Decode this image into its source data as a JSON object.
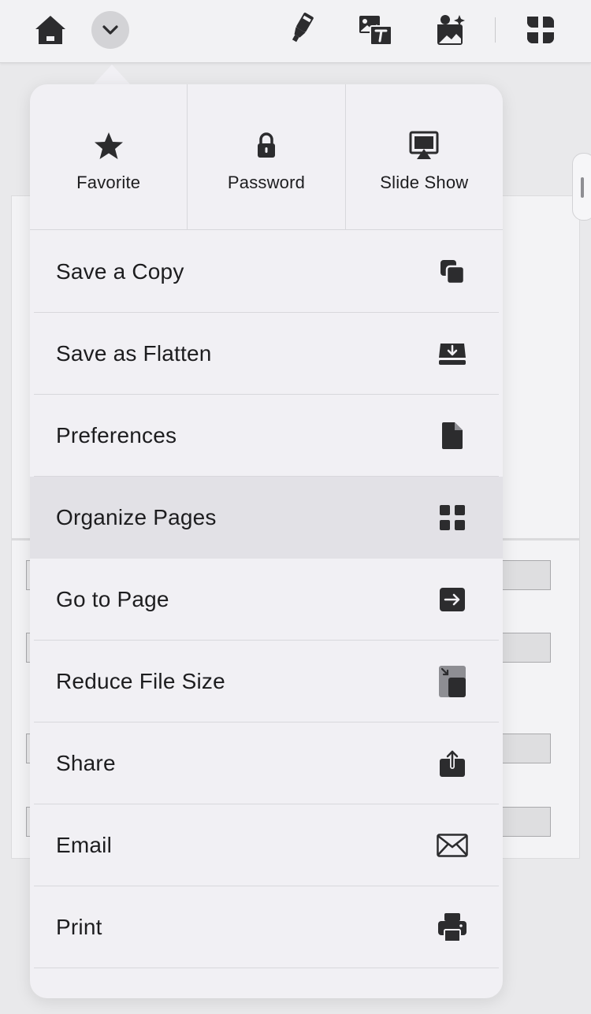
{
  "toolbar": {
    "icons": [
      "home-icon",
      "chevron-down-icon",
      "highlighter-icon",
      "image-text-icon",
      "ai-image-icon",
      "apps-grid-icon"
    ]
  },
  "menu": {
    "quick_actions": [
      {
        "label": "Favorite",
        "icon": "star-icon"
      },
      {
        "label": "Password",
        "icon": "lock-icon"
      },
      {
        "label": "Slide Show",
        "icon": "slideshow-icon"
      }
    ],
    "items": [
      {
        "label": "Save a Copy",
        "icon": "copy-icon"
      },
      {
        "label": "Save as Flatten",
        "icon": "flatten-download-icon"
      },
      {
        "label": "Preferences",
        "icon": "document-icon"
      },
      {
        "label": "Organize Pages",
        "icon": "grid-icon",
        "highlighted": true
      },
      {
        "label": "Go to Page",
        "icon": "arrow-right-box-icon"
      },
      {
        "label": "Reduce File Size",
        "icon": "reduce-size-icon"
      },
      {
        "label": "Share",
        "icon": "share-icon"
      },
      {
        "label": "Email",
        "icon": "envelope-icon"
      },
      {
        "label": "Print",
        "icon": "printer-icon"
      }
    ]
  },
  "colors": {
    "background": "#e9e9eb",
    "popover": "#f1f0f4",
    "highlight": "#e2e1e6",
    "icon": "#2c2c2e",
    "text": "#1d1d1f"
  }
}
